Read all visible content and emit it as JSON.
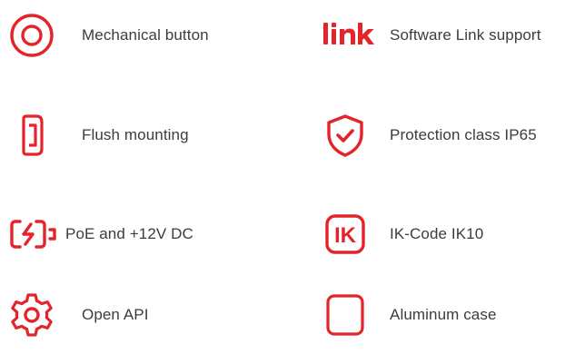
{
  "accent_color": "#e3242b",
  "features": [
    {
      "icon": "button-icon",
      "label": "Mechanical button"
    },
    {
      "icon": "link-logo-icon",
      "label": "Software Link support"
    },
    {
      "icon": "flush-mount-icon",
      "label": "Flush mounting"
    },
    {
      "icon": "shield-check-icon",
      "label": "Protection class IP65"
    },
    {
      "icon": "power-icon",
      "label": "PoE and +12V DC"
    },
    {
      "icon": "ik-code-icon",
      "label": "IK-Code IK10",
      "icon_text": "IK"
    },
    {
      "icon": "gear-icon",
      "label": "Open API"
    },
    {
      "icon": "rounded-square-icon",
      "label": "Aluminum case"
    }
  ]
}
